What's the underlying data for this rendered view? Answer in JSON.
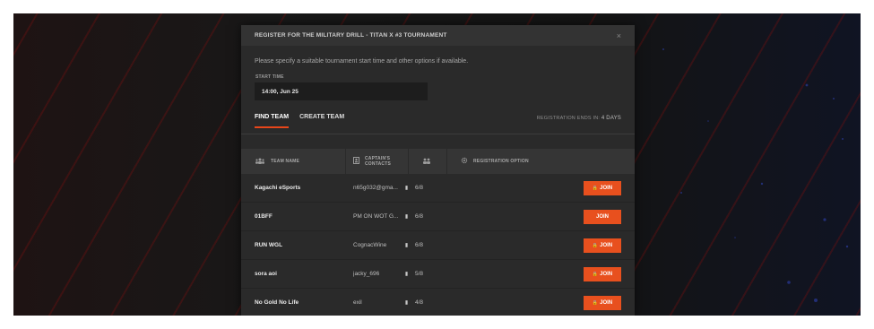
{
  "modal": {
    "title": "REGISTER FOR THE MILITARY DRILL - TITAN X #3 TOURNAMENT",
    "close": "×",
    "description": "Please specify a suitable tournament start time and other options if available.",
    "start_time_label": "START TIME",
    "start_time_value": "14:00, Jun 25"
  },
  "tabs": [
    {
      "label": "FIND TEAM",
      "active": true
    },
    {
      "label": "CREATE TEAM",
      "active": false
    }
  ],
  "registration": {
    "prefix": "REGISTRATION ENDS IN:",
    "value": "4 DAYS"
  },
  "table": {
    "headers": {
      "team_name": "TEAM NAME",
      "captains_contacts": "CAPTAIN'S CONTACTS",
      "registration_option": "REGISTRATION OPTION"
    },
    "rows": [
      {
        "team": "Kagachi eSports",
        "contact": "n65g032@gma...",
        "count": "6/8",
        "action": "JOIN",
        "locked": true
      },
      {
        "team": "01BFF",
        "contact": "PM ON WOT G...",
        "count": "6/8",
        "action": "JOIN",
        "locked": false
      },
      {
        "team": "RUN WGL",
        "contact": "CognacWine",
        "count": "6/8",
        "action": "JOIN",
        "locked": true
      },
      {
        "team": "sora aoi",
        "contact": "jacky_696",
        "count": "5/8",
        "action": "JOIN",
        "locked": true
      },
      {
        "team": "No Gold No Life",
        "contact": "exil",
        "count": "4/8",
        "action": "JOIN",
        "locked": true
      }
    ]
  },
  "colors": {
    "accent": "#e8501e",
    "modal_bg": "#2a2a2a",
    "header_bg": "#353535"
  }
}
